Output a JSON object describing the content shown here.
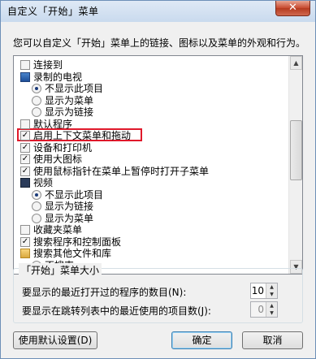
{
  "window": {
    "title": "自定义「开始」菜单",
    "close_label": "✕"
  },
  "intro": "您可以自定义「开始」菜单上的链接、图标以及菜单的外观和行为。",
  "list_items": [
    {
      "kind": "checkbox",
      "label": "连接到",
      "checked": false
    },
    {
      "kind": "icon",
      "icon": "tv-icon",
      "label": "录制的电视"
    },
    {
      "kind": "radio",
      "label": "不显示此项目",
      "checked": true
    },
    {
      "kind": "radio",
      "label": "显示为菜单",
      "checked": false
    },
    {
      "kind": "radio",
      "label": "显示为链接",
      "checked": false
    },
    {
      "kind": "checkbox",
      "label": "默认程序",
      "checked": false
    },
    {
      "kind": "checkbox",
      "label": "启用上下文菜单和拖动",
      "checked": true
    },
    {
      "kind": "checkbox",
      "label": "设备和打印机",
      "checked": true
    },
    {
      "kind": "checkbox",
      "label": "使用大图标",
      "checked": true
    },
    {
      "kind": "checkbox",
      "label": "使用鼠标指针在菜单上暂停时打开子菜单",
      "checked": true
    },
    {
      "kind": "icon",
      "icon": "video-icon",
      "label": "视频"
    },
    {
      "kind": "radio",
      "label": "不显示此项目",
      "checked": true
    },
    {
      "kind": "radio",
      "label": "显示为链接",
      "checked": false
    },
    {
      "kind": "radio",
      "label": "显示为菜单",
      "checked": false
    },
    {
      "kind": "checkbox",
      "label": "收藏夹菜单",
      "checked": false
    },
    {
      "kind": "checkbox",
      "label": "搜索程序和控制面板",
      "checked": true
    },
    {
      "kind": "icon",
      "icon": "folder-search-icon",
      "label": "搜索其他文件和库"
    },
    {
      "kind": "radio",
      "label": "不搜索",
      "checked": false
    }
  ],
  "size_group": {
    "legend": "「开始」菜单大小",
    "recent_programs_label": "要显示的最近打开过的程序的数目(N):",
    "recent_programs_value": "10",
    "jump_list_label": "要显示在跳转列表中的最近使用的项目数(J):",
    "jump_list_value": "0"
  },
  "buttons": {
    "defaults": "使用默认设置(D)",
    "ok": "确定",
    "cancel": "取消"
  },
  "highlight_color": "#e0192b"
}
